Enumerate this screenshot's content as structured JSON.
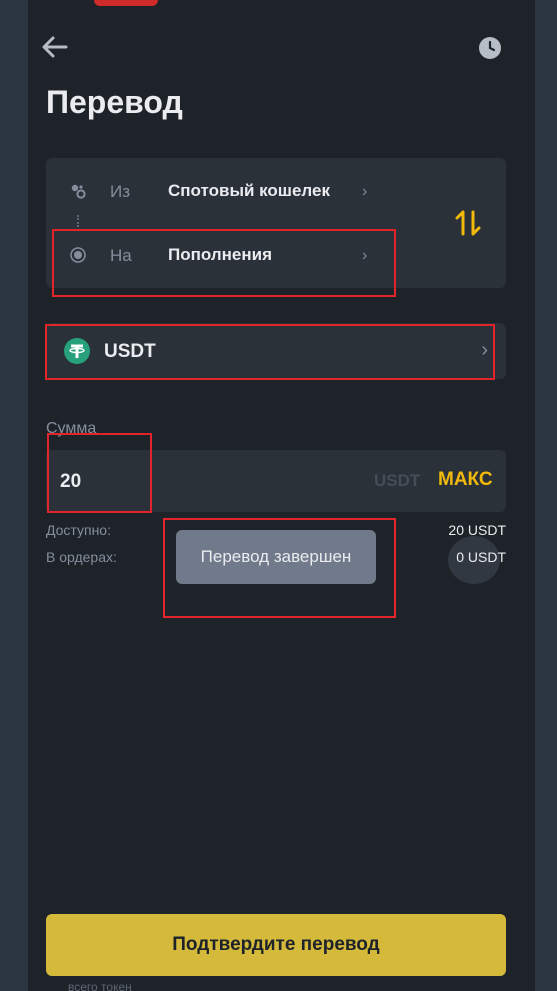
{
  "header": {
    "title": "Перевод"
  },
  "transfer": {
    "from": {
      "label": "Из",
      "value": "Спотовый кошелек",
      "chevron": "›"
    },
    "to": {
      "label": "На",
      "value": "Пополнения",
      "chevron": "›"
    },
    "icons": {
      "back": "arrow-left",
      "history": "clock",
      "swap": "swap-vertical-arrows"
    }
  },
  "coin": {
    "name": "USDT",
    "chevron": "›",
    "icon": "tether-logo",
    "icon_color": "#26a17b"
  },
  "amount": {
    "label": "Сумма",
    "value": "20",
    "unit": "USDT",
    "max_label": "МАКС"
  },
  "balances": {
    "available_label": "Доступно:",
    "available_value": "20 USDT",
    "in_orders_label": "В ордерах:",
    "in_orders_value": "0 USDT"
  },
  "toast": {
    "text": "Перевод завершен"
  },
  "actions": {
    "confirm_label": "Подтвердите перевод"
  },
  "footer": {
    "hint": "всего токен"
  },
  "colors": {
    "background": "#1e2329",
    "surface": "#2b3139",
    "accent": "#f0b90b",
    "button": "#d4b93a",
    "highlight": "#e3242b"
  }
}
